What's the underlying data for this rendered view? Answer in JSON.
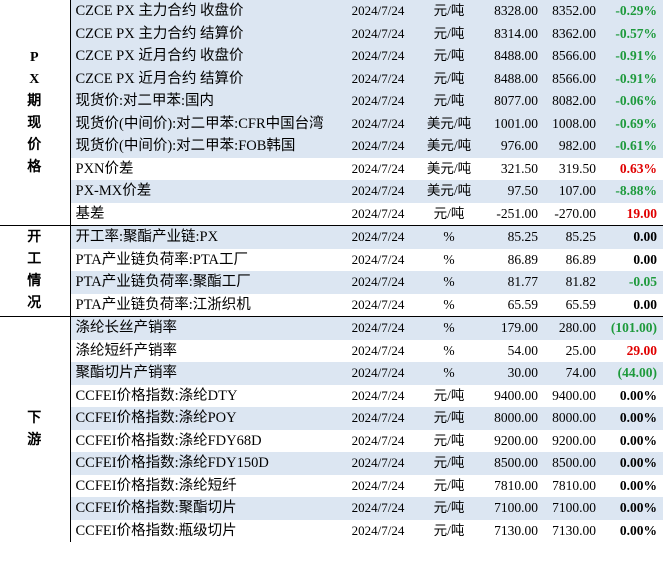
{
  "sections": {
    "px": [
      "P",
      "X",
      "期",
      "现",
      "价",
      "格"
    ],
    "kaigong": [
      "开",
      "工",
      "情",
      "况"
    ],
    "xiayou": [
      "下",
      "游"
    ]
  },
  "rows": [
    {
      "name": "CZCE PX 主力合约 收盘价",
      "date": "2024/7/24",
      "unit": "元/吨",
      "v1": "8328.00",
      "v2": "8352.00",
      "chg": "-0.29%"
    },
    {
      "name": "CZCE PX 主力合约 结算价",
      "date": "2024/7/24",
      "unit": "元/吨",
      "v1": "8314.00",
      "v2": "8362.00",
      "chg": "-0.57%"
    },
    {
      "name": "CZCE PX 近月合约 收盘价",
      "date": "2024/7/24",
      "unit": "元/吨",
      "v1": "8488.00",
      "v2": "8566.00",
      "chg": "-0.91%"
    },
    {
      "name": "CZCE PX 近月合约 结算价",
      "date": "2024/7/24",
      "unit": "元/吨",
      "v1": "8488.00",
      "v2": "8566.00",
      "chg": "-0.91%"
    },
    {
      "name": "现货价:对二甲苯:国内",
      "date": "2024/7/24",
      "unit": "元/吨",
      "v1": "8077.00",
      "v2": "8082.00",
      "chg": "-0.06%"
    },
    {
      "name": "现货价(中间价):对二甲苯:CFR中国台湾",
      "date": "2024/7/24",
      "unit": "美元/吨",
      "v1": "1001.00",
      "v2": "1008.00",
      "chg": "-0.69%"
    },
    {
      "name": "现货价(中间价):对二甲苯:FOB韩国",
      "date": "2024/7/24",
      "unit": "美元/吨",
      "v1": "976.00",
      "v2": "982.00",
      "chg": "-0.61%"
    },
    {
      "name": "PXN价差",
      "date": "2024/7/24",
      "unit": "美元/吨",
      "v1": "321.50",
      "v2": "319.50",
      "chg": "0.63%"
    },
    {
      "name": "PX-MX价差",
      "date": "2024/7/24",
      "unit": "美元/吨",
      "v1": "97.50",
      "v2": "107.00",
      "chg": "-8.88%"
    },
    {
      "name": "基差",
      "date": "2024/7/24",
      "unit": "元/吨",
      "v1": "-251.00",
      "v2": "-270.00",
      "chg": "19.00"
    },
    {
      "name": "开工率:聚酯产业链:PX",
      "date": "2024/7/24",
      "unit": "%",
      "v1": "85.25",
      "v2": "85.25",
      "chg": "0.00"
    },
    {
      "name": "PTA产业链负荷率:PTA工厂",
      "date": "2024/7/24",
      "unit": "%",
      "v1": "86.89",
      "v2": "86.89",
      "chg": "0.00"
    },
    {
      "name": "PTA产业链负荷率:聚酯工厂",
      "date": "2024/7/24",
      "unit": "%",
      "v1": "81.77",
      "v2": "81.82",
      "chg": "-0.05"
    },
    {
      "name": "PTA产业链负荷率:江浙织机",
      "date": "2024/7/24",
      "unit": "%",
      "v1": "65.59",
      "v2": "65.59",
      "chg": "0.00"
    },
    {
      "name": "涤纶长丝产销率",
      "date": "2024/7/24",
      "unit": "%",
      "v1": "179.00",
      "v2": "280.00",
      "chg": "(101.00)"
    },
    {
      "name": "涤纶短纤产销率",
      "date": "2024/7/24",
      "unit": "%",
      "v1": "54.00",
      "v2": "25.00",
      "chg": "29.00"
    },
    {
      "name": "聚酯切片产销率",
      "date": "2024/7/24",
      "unit": "%",
      "v1": "30.00",
      "v2": "74.00",
      "chg": "(44.00)"
    },
    {
      "name": "CCFEI价格指数:涤纶DTY",
      "date": "2024/7/24",
      "unit": "元/吨",
      "v1": "9400.00",
      "v2": "9400.00",
      "chg": "0.00%"
    },
    {
      "name": "CCFEI价格指数:涤纶POY",
      "date": "2024/7/24",
      "unit": "元/吨",
      "v1": "8000.00",
      "v2": "8000.00",
      "chg": "0.00%"
    },
    {
      "name": "CCFEI价格指数:涤纶FDY68D",
      "date": "2024/7/24",
      "unit": "元/吨",
      "v1": "9200.00",
      "v2": "9200.00",
      "chg": "0.00%"
    },
    {
      "name": "CCFEI价格指数:涤纶FDY150D",
      "date": "2024/7/24",
      "unit": "元/吨",
      "v1": "8500.00",
      "v2": "8500.00",
      "chg": "0.00%"
    },
    {
      "name": "CCFEI价格指数:涤纶短纤",
      "date": "2024/7/24",
      "unit": "元/吨",
      "v1": "7810.00",
      "v2": "7810.00",
      "chg": "0.00%"
    },
    {
      "name": "CCFEI价格指数:聚酯切片",
      "date": "2024/7/24",
      "unit": "元/吨",
      "v1": "7100.00",
      "v2": "7100.00",
      "chg": "0.00%"
    },
    {
      "name": "CCFEI价格指数:瓶级切片",
      "date": "2024/7/24",
      "unit": "元/吨",
      "v1": "7130.00",
      "v2": "7130.00",
      "chg": "0.00%"
    }
  ],
  "colors": {
    "positive": "#e00000",
    "negative": "#1e9a3c",
    "neutral": "#000000",
    "row_alt": "#dce6f2"
  }
}
